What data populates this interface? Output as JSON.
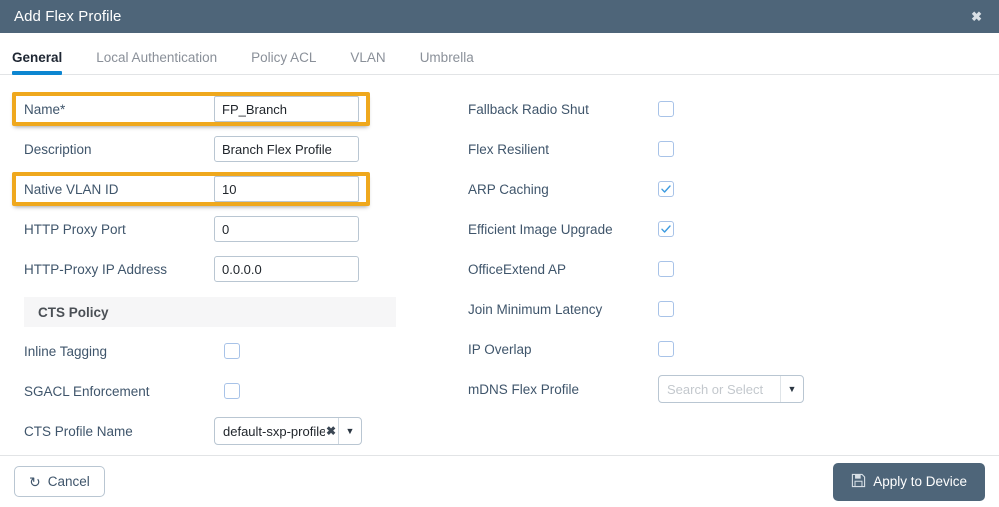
{
  "window": {
    "title": "Add Flex Profile",
    "close_icon": "close-icon",
    "header_color": "#4e6579"
  },
  "tabs": [
    {
      "label": "General",
      "active": true
    },
    {
      "label": "Local Authentication",
      "active": false
    },
    {
      "label": "Policy ACL",
      "active": false
    },
    {
      "label": "VLAN",
      "active": false
    },
    {
      "label": "Umbrella",
      "active": false
    }
  ],
  "accent_color": "#0d86d1",
  "highlight_color": "#efa81d",
  "left_column": {
    "fields": [
      {
        "label": "Name*",
        "value": "FP_Branch",
        "highlighted": true
      },
      {
        "label": "Description",
        "value": "Branch Flex Profile",
        "highlighted": false
      },
      {
        "label": "Native VLAN ID",
        "value": "10",
        "highlighted": true
      },
      {
        "label": "HTTP Proxy Port",
        "value": "0",
        "highlighted": false
      },
      {
        "label": "HTTP-Proxy IP Address",
        "value": "0.0.0.0",
        "highlighted": false
      }
    ],
    "section": {
      "title": "CTS Policy",
      "checkboxes": [
        {
          "label": "Inline Tagging",
          "checked": false
        },
        {
          "label": "SGACL Enforcement",
          "checked": false
        }
      ],
      "select": {
        "label": "CTS Profile Name",
        "value": "default-sxp-profile",
        "clear_icon": "clear-icon",
        "caret_icon": "chevron-down-icon"
      }
    }
  },
  "right_column": {
    "checkboxes": [
      {
        "label": "Fallback Radio Shut",
        "checked": false
      },
      {
        "label": "Flex Resilient",
        "checked": false
      },
      {
        "label": "ARP Caching",
        "checked": true
      },
      {
        "label": "Efficient Image Upgrade",
        "checked": true
      },
      {
        "label": "OfficeExtend AP",
        "checked": false
      },
      {
        "label": "Join Minimum Latency",
        "checked": false
      },
      {
        "label": "IP Overlap",
        "checked": false
      }
    ],
    "select": {
      "label": "mDNS Flex Profile",
      "placeholder": "Search or Select",
      "caret_icon": "chevron-down-icon"
    }
  },
  "footer": {
    "cancel_label": "Cancel",
    "cancel_icon": "undo-icon",
    "apply_label": "Apply to Device",
    "apply_icon": "save-disk-icon"
  }
}
